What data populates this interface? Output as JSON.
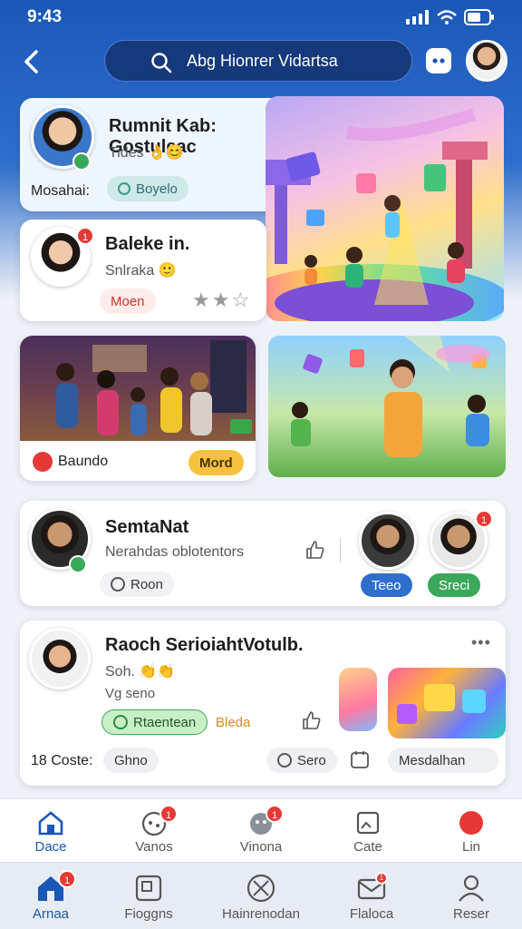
{
  "status": {
    "time": "9:43"
  },
  "search": {
    "value": "Abg Hionrer Vidartsa"
  },
  "card1": {
    "title": "Rumnit Kab: Gostuleac",
    "subtitle": "Tides",
    "label": "Mosahai:",
    "chip": "Boyelo"
  },
  "card2": {
    "title": "Baleke in.",
    "subtitle": "Snlraka",
    "chip": "Moen",
    "badge": "1",
    "rating": 2
  },
  "card3": {
    "label": "Baundo",
    "button": "Mord"
  },
  "card5": {
    "title": "SemtaNat",
    "subtitle": "Nerahdas oblotentors",
    "chip": "Roon",
    "person1_tag": "Teeo",
    "person2_tag": "Sreci",
    "person2_badge": "1"
  },
  "card6": {
    "title": "Raoch SerioiahtVotulb.",
    "line1": "Soh.",
    "line2": "Vg seno",
    "chip_green": "Rtaentean",
    "chip_orange": "Bleda",
    "label": "18 Coste:",
    "chip_grey": "Ghno",
    "chip_send": "Sero",
    "chip_media": "Mesdalhan"
  },
  "tabs_top": [
    {
      "label": "Dace",
      "badge": ""
    },
    {
      "label": "Vanos",
      "badge": "1"
    },
    {
      "label": "Vinona",
      "badge": "1"
    },
    {
      "label": "Cate",
      "badge": ""
    },
    {
      "label": "Lin",
      "badge": ""
    }
  ],
  "tabs_bottom": [
    {
      "label": "Arnaa",
      "badge": "1"
    },
    {
      "label": "Fioggns",
      "badge": ""
    },
    {
      "label": "Hainrenodan",
      "badge": ""
    },
    {
      "label": "Flaloca",
      "badge": "1"
    },
    {
      "label": "Reser",
      "badge": ""
    }
  ],
  "colors": {
    "brand": "#1b57b7",
    "accent_green": "#3aa85a",
    "accent_red": "#e53935",
    "accent_yellow": "#f6c23e"
  }
}
